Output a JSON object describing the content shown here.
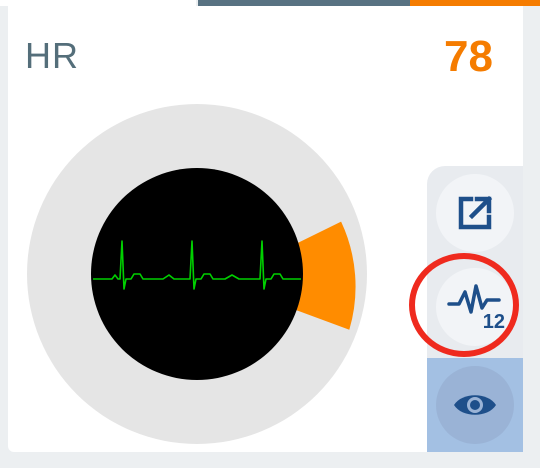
{
  "vital": {
    "label": "HR",
    "value": "78",
    "value_color": "#f57c00",
    "label_color": "#546e7a"
  },
  "gauge": {
    "ring_color": "#e5e5e5",
    "indicator_color": "#ff8c00",
    "screen_color": "#000000",
    "waveform_color": "#00d000"
  },
  "actions": {
    "open_external": {
      "icon": "open-in-new-icon"
    },
    "ecg_12_lead": {
      "icon": "ecg-waveform-icon",
      "badge": "12"
    },
    "view": {
      "icon": "eye-icon"
    }
  },
  "annotation": {
    "color": "#ef2a1e"
  }
}
